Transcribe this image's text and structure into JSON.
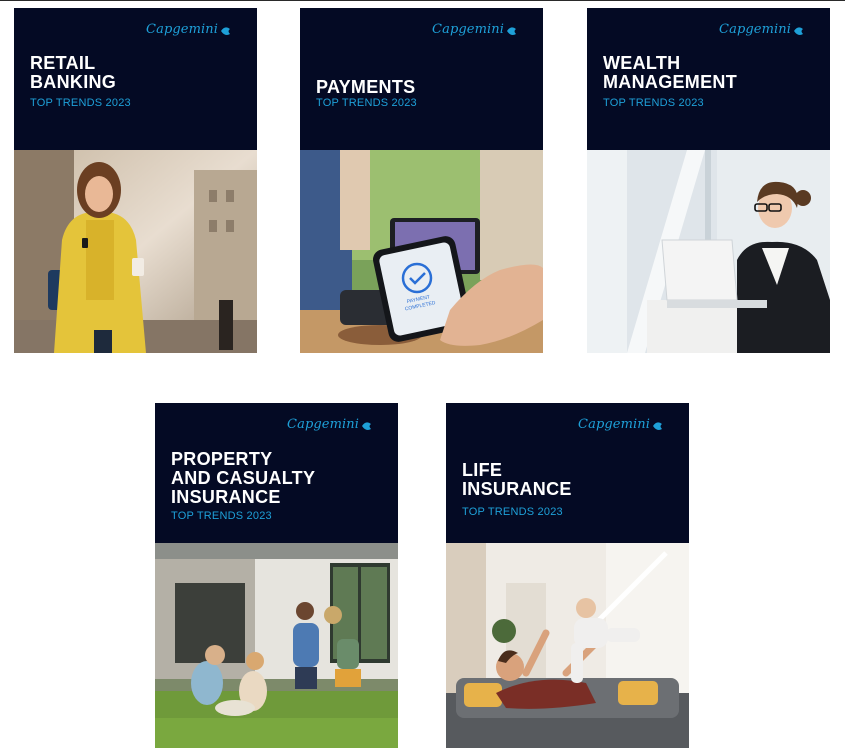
{
  "covers": [
    {
      "brand": "Capgemini",
      "title_lines": [
        "RETAIL",
        "BANKING"
      ],
      "subtitle": "TOP TRENDS 2023",
      "photo_icon": "woman-with-phone-and-coffee-photo"
    },
    {
      "brand": "Capgemini",
      "title_lines": [
        "PAYMENTS"
      ],
      "subtitle": "TOP TRENDS 2023",
      "photo_icon": "contactless-phone-payment-photo",
      "photo_text": [
        "PAYMENT",
        "COMPLETED"
      ]
    },
    {
      "brand": "Capgemini",
      "title_lines": [
        "WEALTH",
        "MANAGEMENT"
      ],
      "subtitle": "TOP TRENDS 2023",
      "photo_icon": "businesswoman-with-laptop-photo"
    },
    {
      "brand": "Capgemini",
      "title_lines": [
        "PROPERTY",
        "AND CASUALTY",
        "INSURANCE"
      ],
      "subtitle": "TOP TRENDS 2023",
      "photo_icon": "family-playing-in-garden-photo"
    },
    {
      "brand": "Capgemini",
      "title_lines": [
        "LIFE",
        "INSURANCE"
      ],
      "subtitle": "TOP TRENDS 2023",
      "photo_icon": "father-lifting-child-on-sofa-photo"
    }
  ],
  "colors": {
    "navy": "#040a24",
    "accent": "#1ea0d8",
    "title": "#ffffff"
  }
}
